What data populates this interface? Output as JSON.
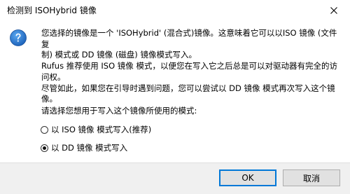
{
  "window": {
    "title": "检测到 ISOHybrid 镜像"
  },
  "message": {
    "line1": "您选择的镜像是一个 'ISOHybrid' (混合式)镜像。这意味着它可以以ISO 镜像 (文件复",
    "line2": "制) 模式或 DD 镜像 (磁盘) 镜像模式写入。",
    "line3": "Rufus 推荐使用 ISO 镜像 模式，以便您在写入它之后总是可以对驱动器有完全的访",
    "line4": "问权。",
    "line5": "尽管如此，如果您在引导时遇到问题，您可以尝试以 DD 镜像 模式再次写入这个镜像。"
  },
  "prompt": "请选择您想用于写入这个镜像所使用的模式:",
  "options": [
    {
      "label": "以 ISO 镜像 模式写入(推荐)",
      "checked": false
    },
    {
      "label": "以 DD 镜像 模式写入",
      "checked": true
    }
  ],
  "buttons": {
    "ok": "OK",
    "cancel": "取消"
  },
  "colors": {
    "accent": "#0078d7",
    "icon_blue": "#1e6fc8",
    "footer_bg": "#f0f0f0"
  },
  "icons": {
    "close": "close-icon",
    "question": "question-icon"
  }
}
